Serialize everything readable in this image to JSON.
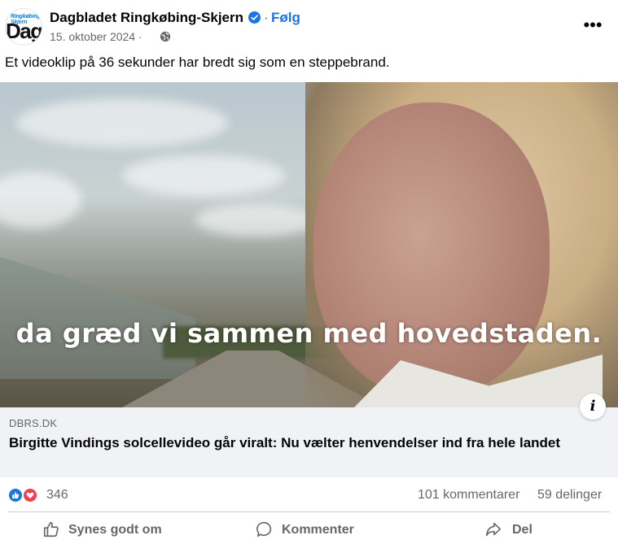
{
  "post": {
    "page_name": "Dagbladet Ringkøbing-Skjern",
    "follow_label": "Følg",
    "date": "15. oktober 2024 ·",
    "avatar_small_text": "Ringkøbing Skjern",
    "avatar_big_text": "Dag",
    "caption": "Et videoklip på 36 sekunder har bredt sig som en steppebrand."
  },
  "media": {
    "subtitle": "da græd vi sammen med hovedstaden.",
    "info_label": "i"
  },
  "link": {
    "domain": "DBRS.DK",
    "title": "Birgitte Vindings solcellevideo går viralt: Nu vælter henvendelser ind fra hele landet"
  },
  "stats": {
    "reactions_count": "346",
    "comments": "101 kommentarer",
    "shares": "59 delinger"
  },
  "actions": {
    "like": "Synes godt om",
    "comment": "Kommenter",
    "share": "Del"
  },
  "colors": {
    "accent": "#1b74e4",
    "love": "#f33e58",
    "secondary_text": "#65676b",
    "link_bg": "#f0f2f5"
  },
  "icons": {
    "verified": "verified-badge-icon",
    "privacy": "globe-icon",
    "more": "more-options-icon",
    "info": "info-icon",
    "like_reaction": "thumbs-up-reaction-icon",
    "love_reaction": "heart-reaction-icon",
    "like_action": "thumbs-up-icon",
    "comment_action": "speech-bubble-icon",
    "share_action": "share-arrow-icon"
  }
}
